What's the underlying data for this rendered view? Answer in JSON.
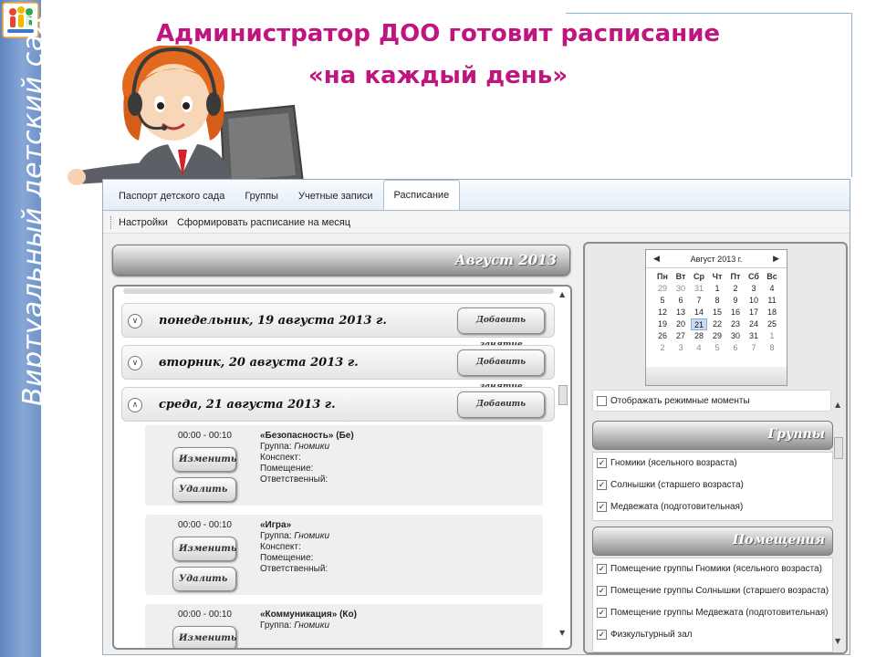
{
  "slide": {
    "title_line1": "Администратор ДОО готовит расписание",
    "title_line2": "«на каждый день»",
    "side_label": "Виртуальный детский сад"
  },
  "app": {
    "tabs": [
      "Паспорт детского сада",
      "Группы",
      "Учетные записи",
      "Расписание"
    ],
    "active_tab": "Расписание",
    "toolbar": [
      "Настройки",
      "Сформировать расписание на месяц"
    ],
    "month_header": "Август 2013",
    "days": [
      {
        "label": "понедельник, 19 августа 2013 г.",
        "expanded": false,
        "add_button": "Добавить занятие"
      },
      {
        "label": "вторник, 20 августа 2013 г.",
        "expanded": false,
        "add_button": "Добавить занятие"
      },
      {
        "label": "среда, 21 августа 2013 г.",
        "expanded": true,
        "add_button": "Добавить занятие"
      }
    ],
    "lessons": [
      {
        "time": "00:00 - 00:10",
        "title": "«Безопасность» (Бе)",
        "group_label": "Группа:",
        "group": "Гномики",
        "notes": "Конспект:",
        "room": "Помещение:",
        "responsible": "Ответственный:",
        "edit": "Изменить",
        "delete": "Удалить"
      },
      {
        "time": "00:00 - 00:10",
        "title": "«Игра»",
        "group_label": "Группа:",
        "group": "Гномики",
        "notes": "Конспект:",
        "room": "Помещение:",
        "responsible": "Ответственный:",
        "edit": "Изменить",
        "delete": "Удалить"
      },
      {
        "time": "00:00 - 00:10",
        "title": "«Коммуникация» (Ко)",
        "group_label": "Группа:",
        "group": "Гномики",
        "edit": "Изменить"
      }
    ],
    "calendar": {
      "header": "Август 2013 г.",
      "dow": [
        "Пн",
        "Вт",
        "Ср",
        "Чт",
        "Пт",
        "Сб",
        "Вс"
      ],
      "weeks": [
        [
          "29",
          "30",
          "31",
          "1",
          "2",
          "3",
          "4"
        ],
        [
          "5",
          "6",
          "7",
          "8",
          "9",
          "10",
          "11"
        ],
        [
          "12",
          "13",
          "14",
          "15",
          "16",
          "17",
          "18"
        ],
        [
          "19",
          "20",
          "21",
          "22",
          "23",
          "24",
          "25"
        ],
        [
          "26",
          "27",
          "28",
          "29",
          "30",
          "31",
          "1"
        ],
        [
          "2",
          "3",
          "4",
          "5",
          "6",
          "7",
          "8"
        ]
      ],
      "selected": "21"
    },
    "show_regime": {
      "label": "Отображать режимные моменты",
      "checked": false
    },
    "groups_header": "Группы",
    "groups": [
      {
        "label": "Гномики (ясельного возраста)",
        "checked": true
      },
      {
        "label": "Солнышки (старшего возраста)",
        "checked": true
      },
      {
        "label": "Медвежата (подготовительная)",
        "checked": true
      }
    ],
    "rooms_header": "Помещения",
    "rooms": [
      {
        "label": "Помещение группы Гномики (ясельного возраста)",
        "checked": true
      },
      {
        "label": "Помещение группы Солнышки (старшего возраста)",
        "checked": true
      },
      {
        "label": "Помещение группы Медвежата (подготовительная)",
        "checked": true
      },
      {
        "label": "Физкультурный зал",
        "checked": true
      }
    ]
  }
}
